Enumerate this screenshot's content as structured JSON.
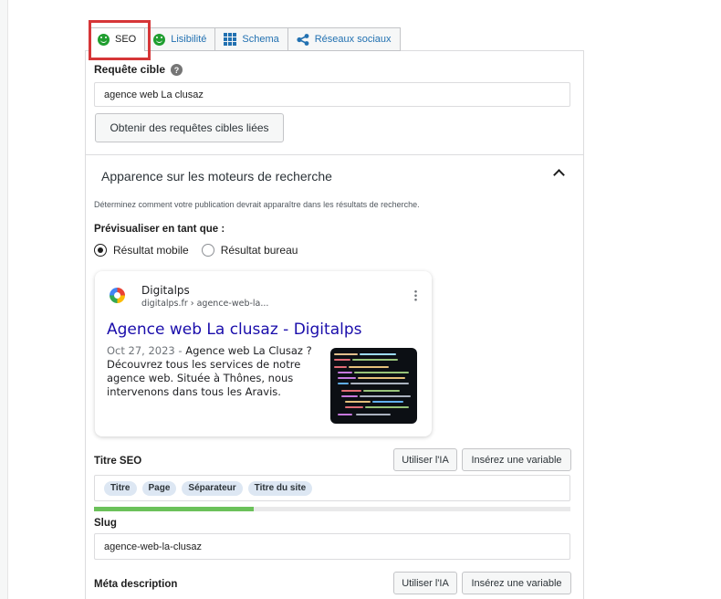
{
  "tabs": [
    {
      "label": "SEO",
      "icon": "smiley-icon",
      "active": true
    },
    {
      "label": "Lisibilité",
      "icon": "smiley-icon"
    },
    {
      "label": "Schema",
      "icon": "grid-icon"
    },
    {
      "label": "Réseaux sociaux",
      "icon": "share-icon"
    }
  ],
  "focus_keyphrase": {
    "label": "Requête cible",
    "value": "agence web La clusaz",
    "related_button": "Obtenir des requêtes cibles liées"
  },
  "search_appearance": {
    "title": "Apparence sur les moteurs de recherche",
    "description": "Déterminez comment votre publication devrait apparaître dans les résultats de recherche.",
    "preview_label": "Prévisualiser en tant que :",
    "options": [
      "Résultat mobile",
      "Résultat bureau"
    ],
    "selected": "Résultat mobile"
  },
  "preview": {
    "site_name": "Digitalps",
    "url": "digitalps.fr › agence-web-la...",
    "title": "Agence web La clusaz - Digitalps",
    "date": "Oct 27, 2023",
    "separator": " - ",
    "snippet": "Agence web La Clusaz ? Découvrez tous les services de notre agence web. Située à Thônes, nous intervenons dans tous les Aravis."
  },
  "seo_title": {
    "label": "Titre SEO",
    "ai_button": "Utiliser l'IA",
    "variable_button": "Insérez une variable",
    "pills": [
      "Titre",
      "Page",
      "Séparateur",
      "Titre du site"
    ],
    "progress": 0.335
  },
  "slug": {
    "label": "Slug",
    "value": "agence-web-la-clusaz"
  },
  "meta_description": {
    "label": "Méta description",
    "ai_button": "Utiliser l'IA",
    "variable_button": "Insérez une variable"
  },
  "colors": {
    "accent": "#2271b1",
    "good": "#1f9e2f",
    "highlight": "#d63638",
    "link": "#1a0dab"
  }
}
